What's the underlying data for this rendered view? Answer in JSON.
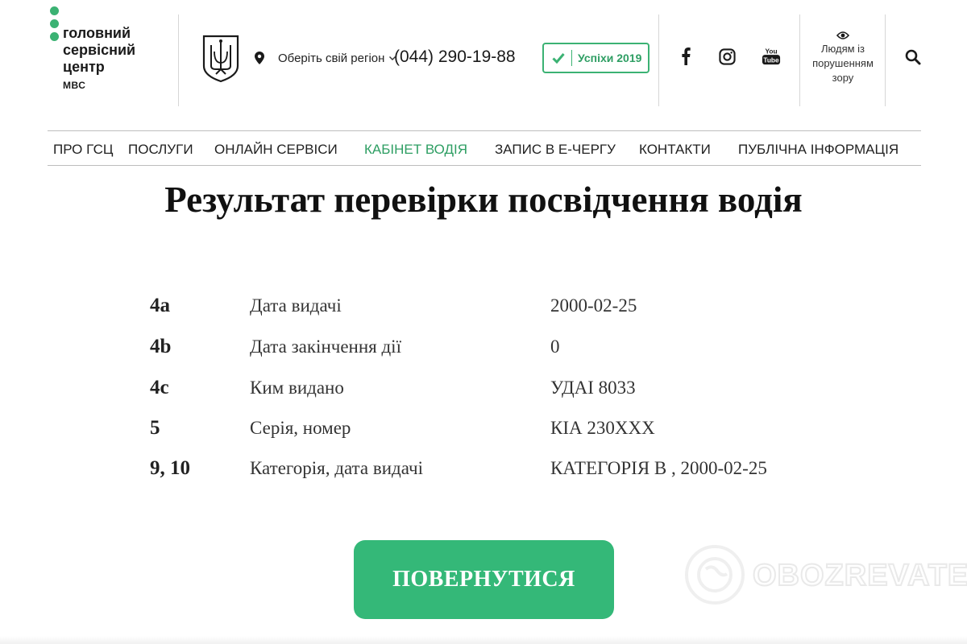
{
  "header": {
    "logo": {
      "lines": [
        "головний",
        "сервісний",
        "центр"
      ],
      "sub": "МВС"
    },
    "region_label": "Оберіть свій регіон",
    "phone": "(044) 290-19-88",
    "success_button": "Успіхи 2019",
    "social_icons": [
      "facebook-icon",
      "instagram-icon",
      "youtube-icon"
    ],
    "accessibility": {
      "lines": [
        "Людям із",
        "порушенням",
        "зору"
      ]
    }
  },
  "nav": {
    "items": [
      {
        "label": "ПРО ГСЦ",
        "active": false
      },
      {
        "label": "ПОСЛУГИ",
        "active": false
      },
      {
        "label": "ОНЛАЙН СЕРВІСИ",
        "active": false
      },
      {
        "label": "КАБІНЕТ ВОДІЯ",
        "active": true
      },
      {
        "label": "ЗАПИС В Е-ЧЕРГУ",
        "active": false
      },
      {
        "label": "КОНТАКТИ",
        "active": false
      },
      {
        "label": "ПУБЛІЧНА ІНФОРМАЦІЯ",
        "active": false
      }
    ]
  },
  "main": {
    "title": "Результат перевірки посвідчення водія",
    "rows": [
      {
        "code": "4a",
        "label": "Дата видачі",
        "value": "2000-02-25"
      },
      {
        "code": "4b",
        "label": "Дата закінчення дії",
        "value": "0"
      },
      {
        "code": "4c",
        "label": "Ким видано",
        "value": "УДАІ 8033"
      },
      {
        "code": "5",
        "label": "Серія, номер",
        "value": "КІА 230XXX"
      },
      {
        "code": "9, 10",
        "label": "Категорія, дата видачі",
        "value": "КАТЕГОРІЯ В , 2000-02-25"
      }
    ],
    "back_button": "ПОВЕРНУТИСЯ"
  },
  "watermark": {
    "text": "OBOZREVATEL"
  },
  "colors": {
    "accent": "#3bb273",
    "button": "#34b878",
    "text": "#1a1a1a"
  }
}
